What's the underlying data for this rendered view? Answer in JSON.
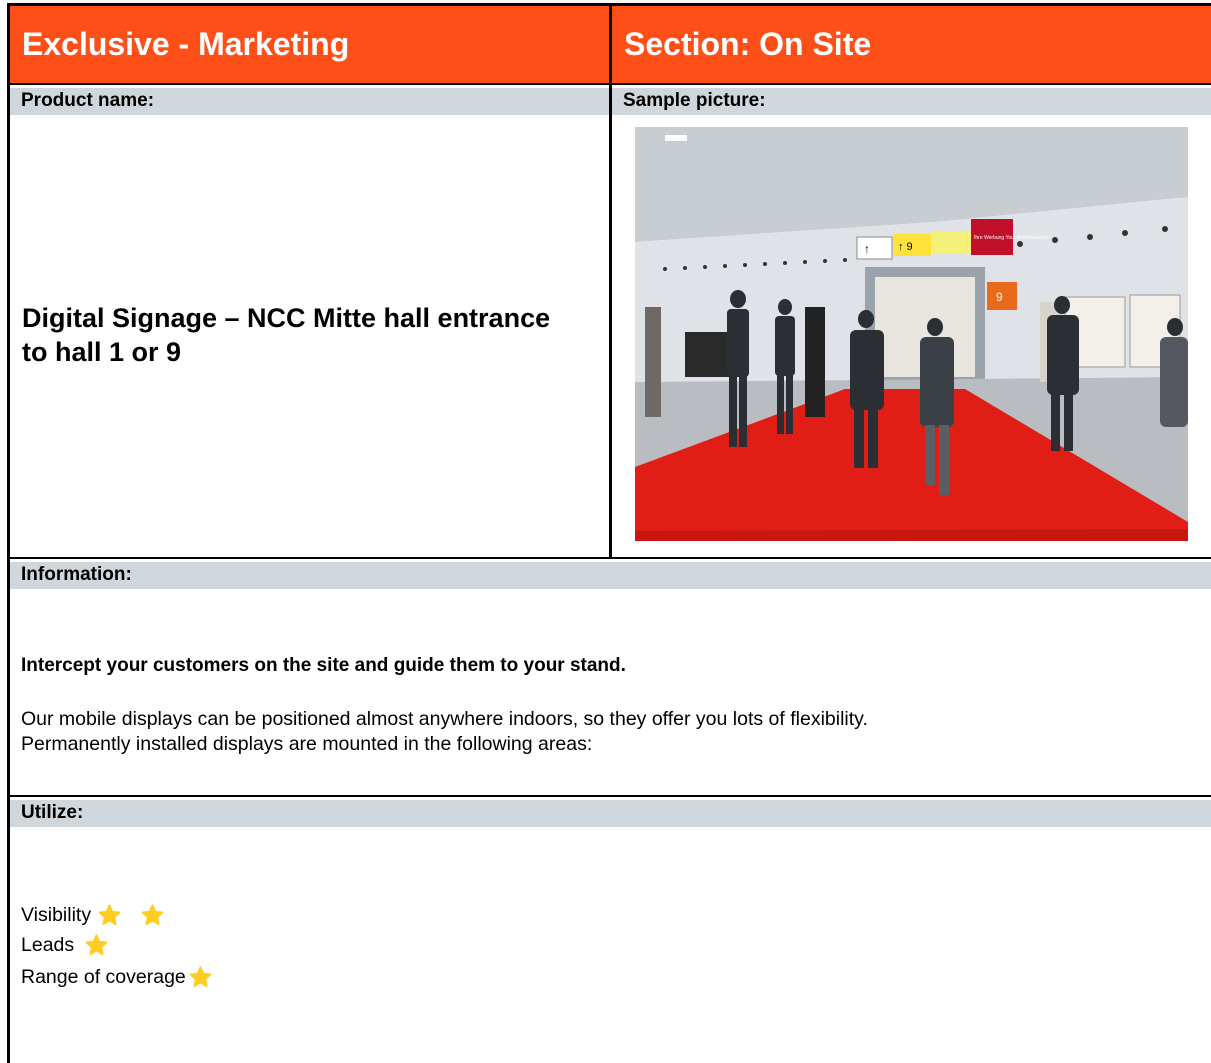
{
  "header": {
    "left_title": "Exclusive - Marketing",
    "right_title": "Section: On Site"
  },
  "product": {
    "label": "Product name:",
    "name": "Digital Signage – NCC Mitte hall entrance to hall 1 or 9"
  },
  "sample": {
    "label": "Sample picture:",
    "image_alt": "Trade fair hall entrance with red carpet, visitors and overhead digital signage",
    "signs": [
      "↑",
      "↑ 9",
      "Ihre Werbung Your Advertisement",
      "9"
    ]
  },
  "information": {
    "label": "Information:",
    "headline": "Intercept your customers on the site and guide them to your stand.",
    "body_line1": "Our mobile displays can be positioned almost anywhere indoors, so they offer you lots of flexibility.",
    "body_line2": "Permanently installed displays are mounted in the following areas:"
  },
  "utilize": {
    "label": "Utilize:",
    "ratings": [
      {
        "label": "Visibility",
        "stars": 2
      },
      {
        "label": "Leads",
        "stars": 1
      },
      {
        "label": "Range of coverage",
        "stars": 1
      }
    ]
  },
  "colors": {
    "header_bg": "#fd4f17",
    "label_bg": "#d0d7dc",
    "star": "#ffcc21"
  }
}
